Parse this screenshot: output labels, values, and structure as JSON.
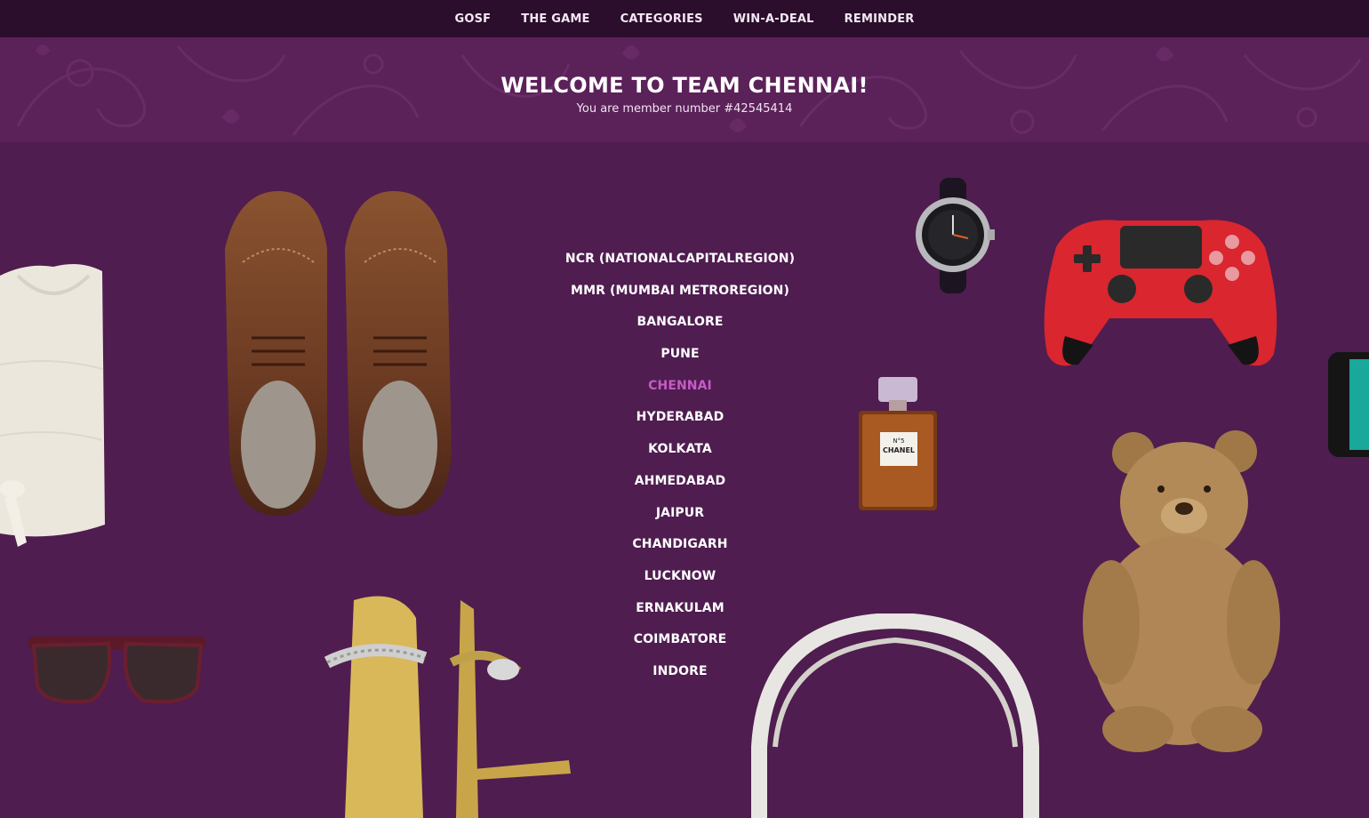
{
  "nav": {
    "items": [
      "GOSF",
      "THE GAME",
      "CATEGORIES",
      "WIN-A-DEAL",
      "REMINDER"
    ]
  },
  "hero": {
    "title": "WELCOME TO TEAM CHENNAI!",
    "subtitle": "You are member number #42545414"
  },
  "cities": {
    "items": [
      "NCR (NATIONALCAPITALREGION)",
      "MMR (MUMBAI METROREGION)",
      "BANGALORE",
      "PUNE",
      "CHENNAI",
      "HYDERABAD",
      "KOLKATA",
      "AHMEDABAD",
      "JAIPUR",
      "CHANDIGARH",
      "LUCKNOW",
      "ERNAKULAM",
      "COIMBATORE",
      "INDORE"
    ],
    "selected": "CHENNAI"
  },
  "perfume": {
    "label_line1": "N°5",
    "label_line2": "CHANEL"
  },
  "colors": {
    "background": "#4f1d4f",
    "nav_bg": "#2b0e2b",
    "hero_bg": "#5b2159",
    "active_city": "#c65bc6"
  }
}
